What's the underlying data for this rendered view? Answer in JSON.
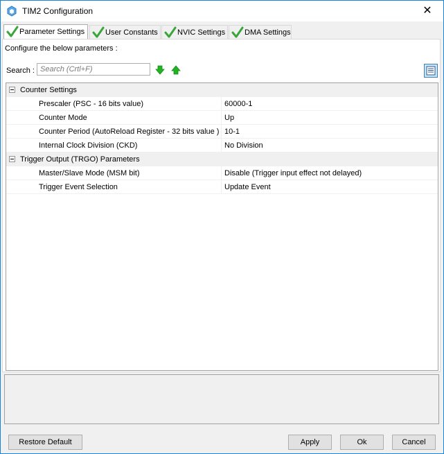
{
  "window": {
    "title": "TIM2 Configuration",
    "close_glyph": "✕"
  },
  "tabs": [
    {
      "label": "Parameter Settings",
      "active": true
    },
    {
      "label": "User Constants",
      "active": false
    },
    {
      "label": "NVIC Settings",
      "active": false
    },
    {
      "label": "DMA Settings",
      "active": false
    }
  ],
  "panel": {
    "config_text": "Configure the below parameters :",
    "search_label": "Search :",
    "search_placeholder": "Search (Crtl+F)",
    "search_value": ""
  },
  "groups": [
    {
      "label": "Counter Settings",
      "params": [
        {
          "name": "Prescaler (PSC - 16 bits value)",
          "value": "60000-1"
        },
        {
          "name": "Counter Mode",
          "value": "Up"
        },
        {
          "name": "Counter Period (AutoReload Register - 32 bits value )",
          "value": "10-1"
        },
        {
          "name": "Internal Clock Division (CKD)",
          "value": "No Division"
        }
      ]
    },
    {
      "label": "Trigger Output (TRGO) Parameters",
      "params": [
        {
          "name": "Master/Slave Mode (MSM bit)",
          "value": "Disable (Trigger input effect not delayed)"
        },
        {
          "name": "Trigger Event Selection",
          "value": "Update Event"
        }
      ]
    }
  ],
  "buttons": {
    "restore": "Restore Default",
    "apply": "Apply",
    "ok": "Ok",
    "cancel": "Cancel"
  },
  "colors": {
    "accent": "#1883d7",
    "check_green": "#3aa63a",
    "arrow_green": "#22b322"
  },
  "icons": {
    "app": "stm32-cube-icon",
    "tab_check": "green-check-icon",
    "down": "green-down-arrow-icon",
    "up": "green-up-arrow-icon",
    "view": "list-view-icon"
  }
}
